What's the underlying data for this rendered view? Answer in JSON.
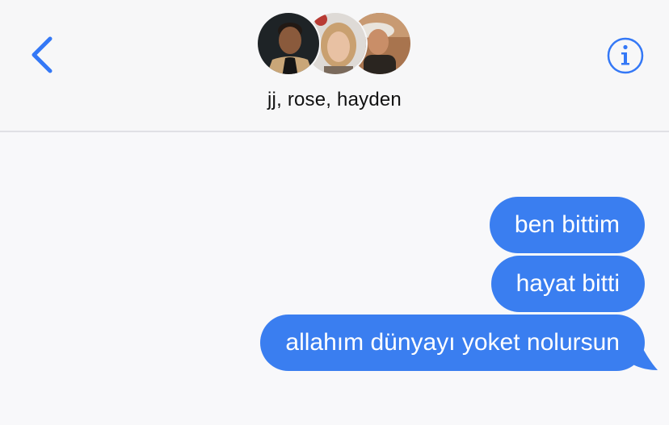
{
  "header": {
    "group_name": "jj, rose, hayden",
    "participants": [
      "jj",
      "rose",
      "hayden"
    ],
    "back_icon": "chevron-left-icon",
    "info_icon": "info-icon"
  },
  "messages": [
    {
      "sender": "me",
      "text": "ben bittim"
    },
    {
      "sender": "me",
      "text": "hayat bitti"
    },
    {
      "sender": "me",
      "text": "allahım dünyayı yoket nolursun"
    }
  ],
  "colors": {
    "accent": "#3478f6",
    "bubble": "#3a7ef0",
    "bubble_text": "#ffffff",
    "background": "#f8f8fa"
  }
}
